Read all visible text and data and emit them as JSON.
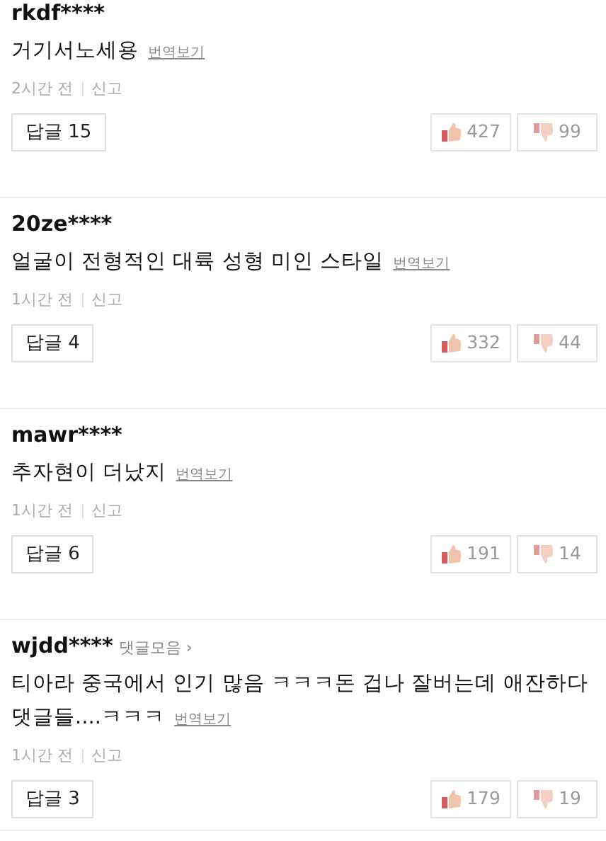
{
  "comments": [
    {
      "user": "rkdf****",
      "text": "거기서노세용",
      "translate": "번역보기",
      "time": "2시간 전",
      "report": "신고",
      "reply": "답글 15",
      "likes": "427",
      "dislikes": "99"
    },
    {
      "user": "20ze****",
      "text": "얼굴이 전형적인 대륙 성형 미인 스타일",
      "translate": "번역보기",
      "time": "1시간 전",
      "report": "신고",
      "reply": "답글 4",
      "likes": "332",
      "dislikes": "44"
    },
    {
      "user": "mawr****",
      "text": "추자현이 더났지",
      "translate": "번역보기",
      "time": "1시간 전",
      "report": "신고",
      "reply": "답글 6",
      "likes": "191",
      "dislikes": "14"
    },
    {
      "user": "wjdd****",
      "collection": "댓글모음 ›",
      "text": "티아라 중국에서 인기 많음 ㅋㅋㅋ돈 겁나 잘버는데 애잔하다 댓글들....ㅋㅋㅋ",
      "translate": "번역보기",
      "time": "1시간 전",
      "report": "신고",
      "reply": "답글 3",
      "likes": "179",
      "dislikes": "19"
    }
  ]
}
